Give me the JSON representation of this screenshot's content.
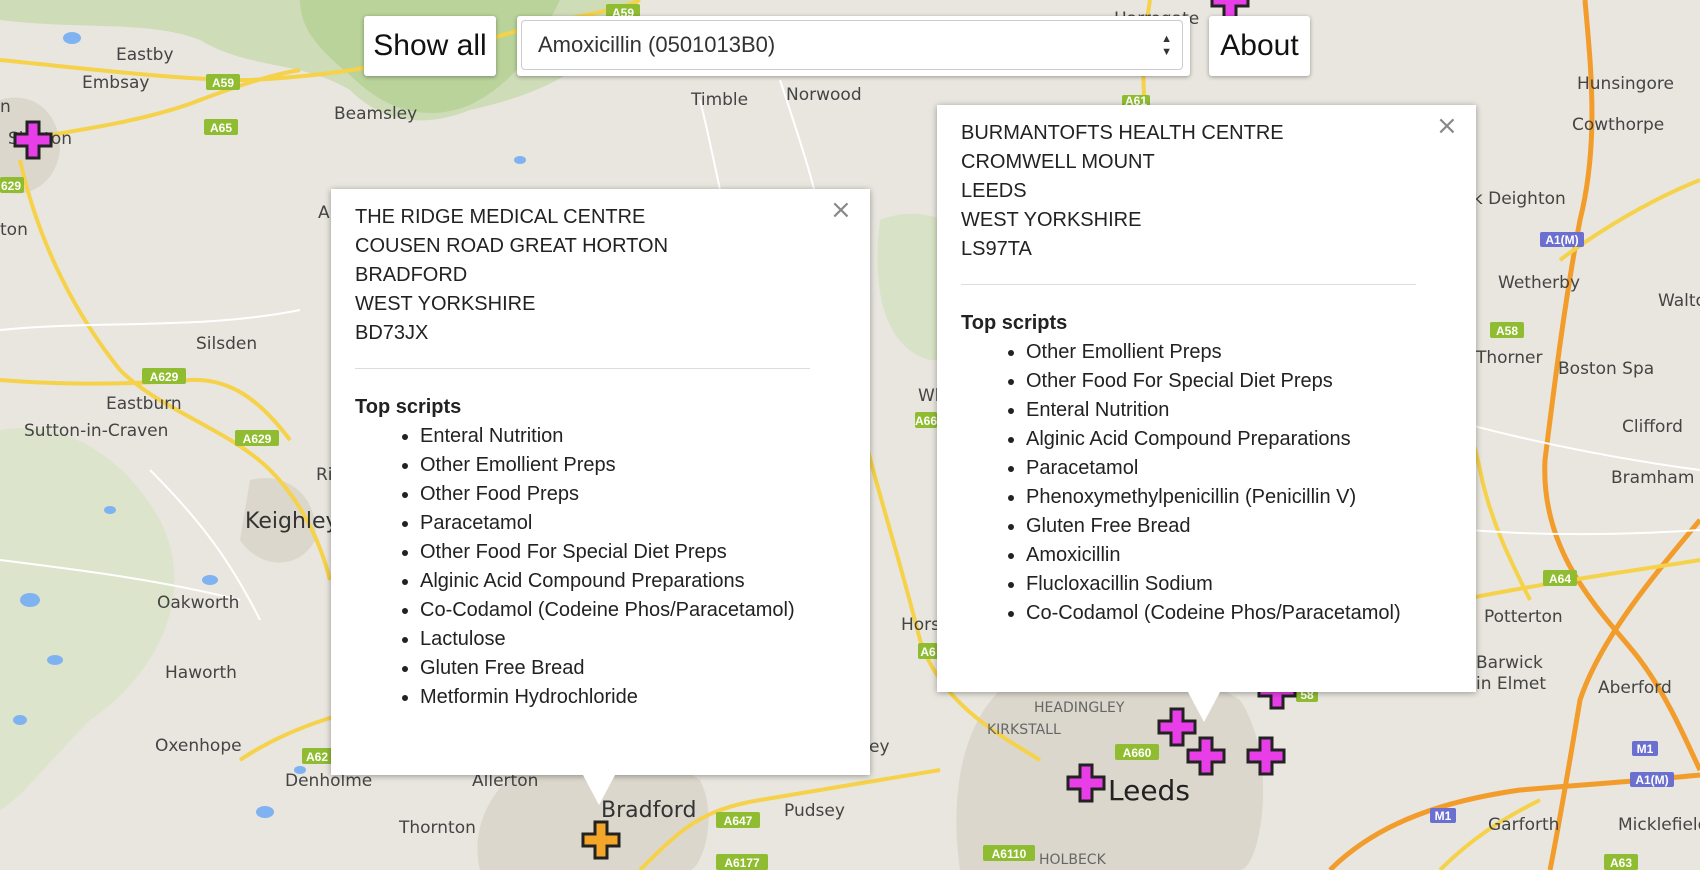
{
  "controls": {
    "show_all_label": "Show all",
    "drug_select_value": "Amoxicillin (0501013B0)",
    "about_label": "About"
  },
  "map": {
    "places": {
      "eastby": "Eastby",
      "embsay": "Embsay",
      "skipton": "Skipton",
      "beamsley": "Beamsley",
      "timble": "Timble",
      "norwood": "Norwood",
      "harrogate": "Harrogate",
      "hunsingore": "Hunsingore",
      "cowthorpe": "Cowthorpe",
      "kirk_deighton": "Kirk Deighton",
      "wetherby": "Wetherby",
      "walton": "Walton",
      "boston_spa": "Boston Spa",
      "bramham_moor": "Thorner",
      "clifford": "Clifford",
      "bramham": "Bramham",
      "silsden": "Silsden",
      "eastburn": "Eastburn",
      "sutton": "Sutton-in-Craven",
      "keighley": "Keighley",
      "oakworth": "Oakworth",
      "haworth": "Haworth",
      "oxenhope": "Oxenhope",
      "denholme": "Denholme",
      "allerton": "Allerton",
      "thornton": "Thornton",
      "bradford": "Bradford",
      "pudsey": "Pudsey",
      "horsforth": "Horsforth",
      "headingley": "HEADINGLEY",
      "kirkstall": "KIRKSTALL",
      "leeds": "Leeds",
      "holbeck": "HOLBECK",
      "potterton": "Potterton",
      "barwick": "Barwick",
      "in_elmet": "in Elmet",
      "aberford": "Aberford",
      "garforth": "Garforth",
      "micklefield": "Micklefield",
      "carlton": "ton",
      "eley": "ey",
      "whar": "Wh",
      "ri": "Ri",
      "a_left": "A",
      "n_left": "n"
    },
    "roads": {
      "a59": "A59",
      "a65": "A65",
      "a629_a": "A629",
      "a629_b": "A629",
      "a629_c": "629",
      "a61": "A61",
      "a660_a": "A66",
      "a660_b": "A6",
      "a660_c": "A660",
      "a647": "A647",
      "a6177": "A6177",
      "a6110": "A6110",
      "a58": "A58",
      "a58_b": "58",
      "a64": "A64",
      "a63": "A63",
      "a62": "A62",
      "a1m_a": "A1(M)",
      "a1m_b": "A1(M)",
      "m1_a": "M1",
      "m1_b": "M1"
    }
  },
  "popups": {
    "ridge": {
      "address": [
        "THE RIDGE MEDICAL CENTRE",
        "COUSEN ROAD GREAT HORTON",
        "BRADFORD",
        "WEST YORKSHIRE",
        "BD73JX"
      ],
      "top_scripts_label": "Top scripts",
      "scripts": [
        "Enteral Nutrition",
        "Other Emollient Preps",
        "Other Food Preps",
        "Paracetamol",
        "Other Food For Special Diet Preps",
        "Alginic Acid Compound Preparations",
        "Co-Codamol (Codeine Phos/Paracetamol)",
        "Lactulose",
        "Gluten Free Bread",
        "Metformin Hydrochloride"
      ],
      "close_label": "×"
    },
    "burmantofts": {
      "address": [
        "BURMANTOFTS HEALTH CENTRE",
        "CROMWELL MOUNT",
        "LEEDS",
        "WEST YORKSHIRE",
        "LS97TA"
      ],
      "top_scripts_label": "Top scripts",
      "scripts": [
        "Other Emollient Preps",
        "Other Food For Special Diet Preps",
        "Enteral Nutrition",
        "Alginic Acid Compound Preparations",
        "Paracetamol",
        "Phenoxymethylpenicillin (Penicillin V)",
        "Gluten Free Bread",
        "Amoxicillin",
        "Flucloxacillin Sodium",
        "Co-Codamol (Codeine Phos/Paracetamol)"
      ],
      "close_label": "×"
    }
  },
  "colors": {
    "marker_default": "#e83ee8",
    "marker_selected": "#f4a62a",
    "motorway": "#f29c2b",
    "a_road": "#f5d24a",
    "road_shield": "#8fbc30",
    "motorway_shield": "#6b6fd0",
    "water": "#7fb2f0",
    "park": "#cfe1b5"
  }
}
